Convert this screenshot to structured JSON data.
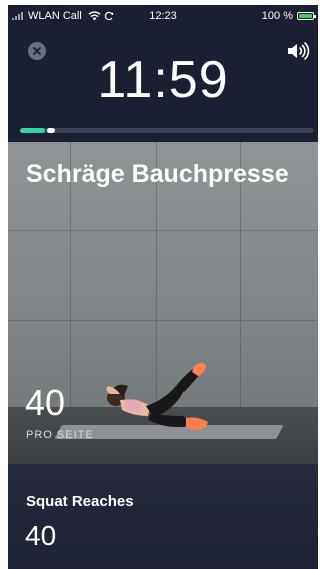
{
  "status_bar": {
    "carrier": "WLAN Call",
    "time": "12:23",
    "battery_percent": "100 %"
  },
  "header": {
    "close_icon": "close-icon",
    "sound_icon": "speaker-icon",
    "timer": "11:59",
    "progress_fraction": 0.12
  },
  "current_exercise": {
    "title": "Schräge Bauchpresse",
    "reps": "40",
    "unit": "PRO SEITE"
  },
  "next_exercise": {
    "name": "Squat Reaches",
    "reps": "40"
  },
  "colors": {
    "background": "#1a1f31",
    "progress": "#2fd8a3",
    "shoe_accent": "#ff7f4f"
  }
}
